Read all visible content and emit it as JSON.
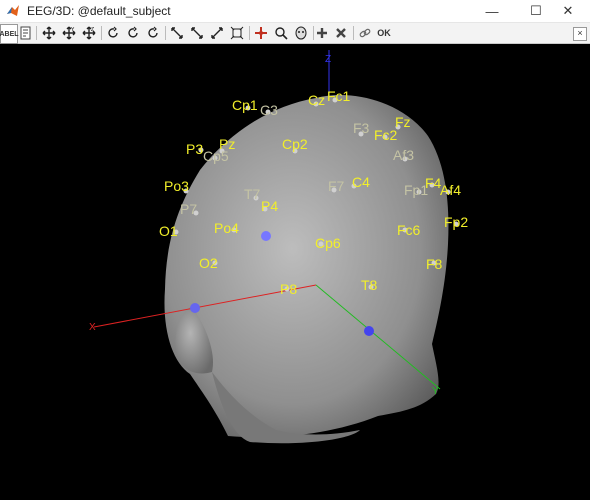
{
  "window": {
    "title": "EEG/3D: @default_subject",
    "buttons": {
      "minimize": "—",
      "maximize": "☐",
      "close": "✕"
    }
  },
  "toolbar": {
    "label_button": "ABEL",
    "ok_label": "OK",
    "close_label": "×",
    "icons": [
      "label-icon",
      "notes-icon",
      "move-icon",
      "move-y-icon",
      "move-z-icon",
      "rotate-x-icon",
      "rotate-y-icon",
      "rotate-z-icon",
      "tilt-x-icon",
      "tilt-y-icon",
      "tilt-z-icon",
      "fit-icon",
      "pan-icon",
      "zoom-icon",
      "head-icon",
      "add-icon",
      "delete-icon",
      "link-icon",
      "ok-icon"
    ]
  },
  "axes": {
    "x": "X",
    "y": "Y",
    "z": "Z"
  },
  "colors": {
    "front_label": "#f2ef2a",
    "back_label": "#c4c3a4",
    "head": "#8c8c8c",
    "x_axis": "#dd2222",
    "y_axis": "#22bb22",
    "z_axis": "#3333ee",
    "fiducial": "#7777ff",
    "electrode_dot": "#d0d0d0"
  },
  "electrodes": [
    {
      "name": "Cp1",
      "back": false
    },
    {
      "name": "C3",
      "back": true
    },
    {
      "name": "Cz",
      "back": false
    },
    {
      "name": "Fc1",
      "back": false
    },
    {
      "name": "Fz",
      "back": false
    },
    {
      "name": "F3",
      "back": true
    },
    {
      "name": "Fc2",
      "back": false
    },
    {
      "name": "Af3",
      "back": true
    },
    {
      "name": "P3",
      "back": false
    },
    {
      "name": "Pz",
      "back": false
    },
    {
      "name": "Cp5",
      "back": true
    },
    {
      "name": "Cp2",
      "back": false
    },
    {
      "name": "C4",
      "back": false
    },
    {
      "name": "F7",
      "back": true
    },
    {
      "name": "Fp1",
      "back": true
    },
    {
      "name": "F4",
      "back": false
    },
    {
      "name": "Af4",
      "back": false
    },
    {
      "name": "Po3",
      "back": false
    },
    {
      "name": "T7",
      "back": true
    },
    {
      "name": "P7",
      "back": true
    },
    {
      "name": "P4",
      "back": false
    },
    {
      "name": "Fp2",
      "back": false
    },
    {
      "name": "O1",
      "back": false
    },
    {
      "name": "Po4",
      "back": false
    },
    {
      "name": "Cp6",
      "back": false
    },
    {
      "name": "Fc6",
      "back": false
    },
    {
      "name": "O2",
      "back": false
    },
    {
      "name": "F8",
      "back": false
    },
    {
      "name": "P8",
      "back": false
    },
    {
      "name": "T8",
      "back": false
    }
  ]
}
